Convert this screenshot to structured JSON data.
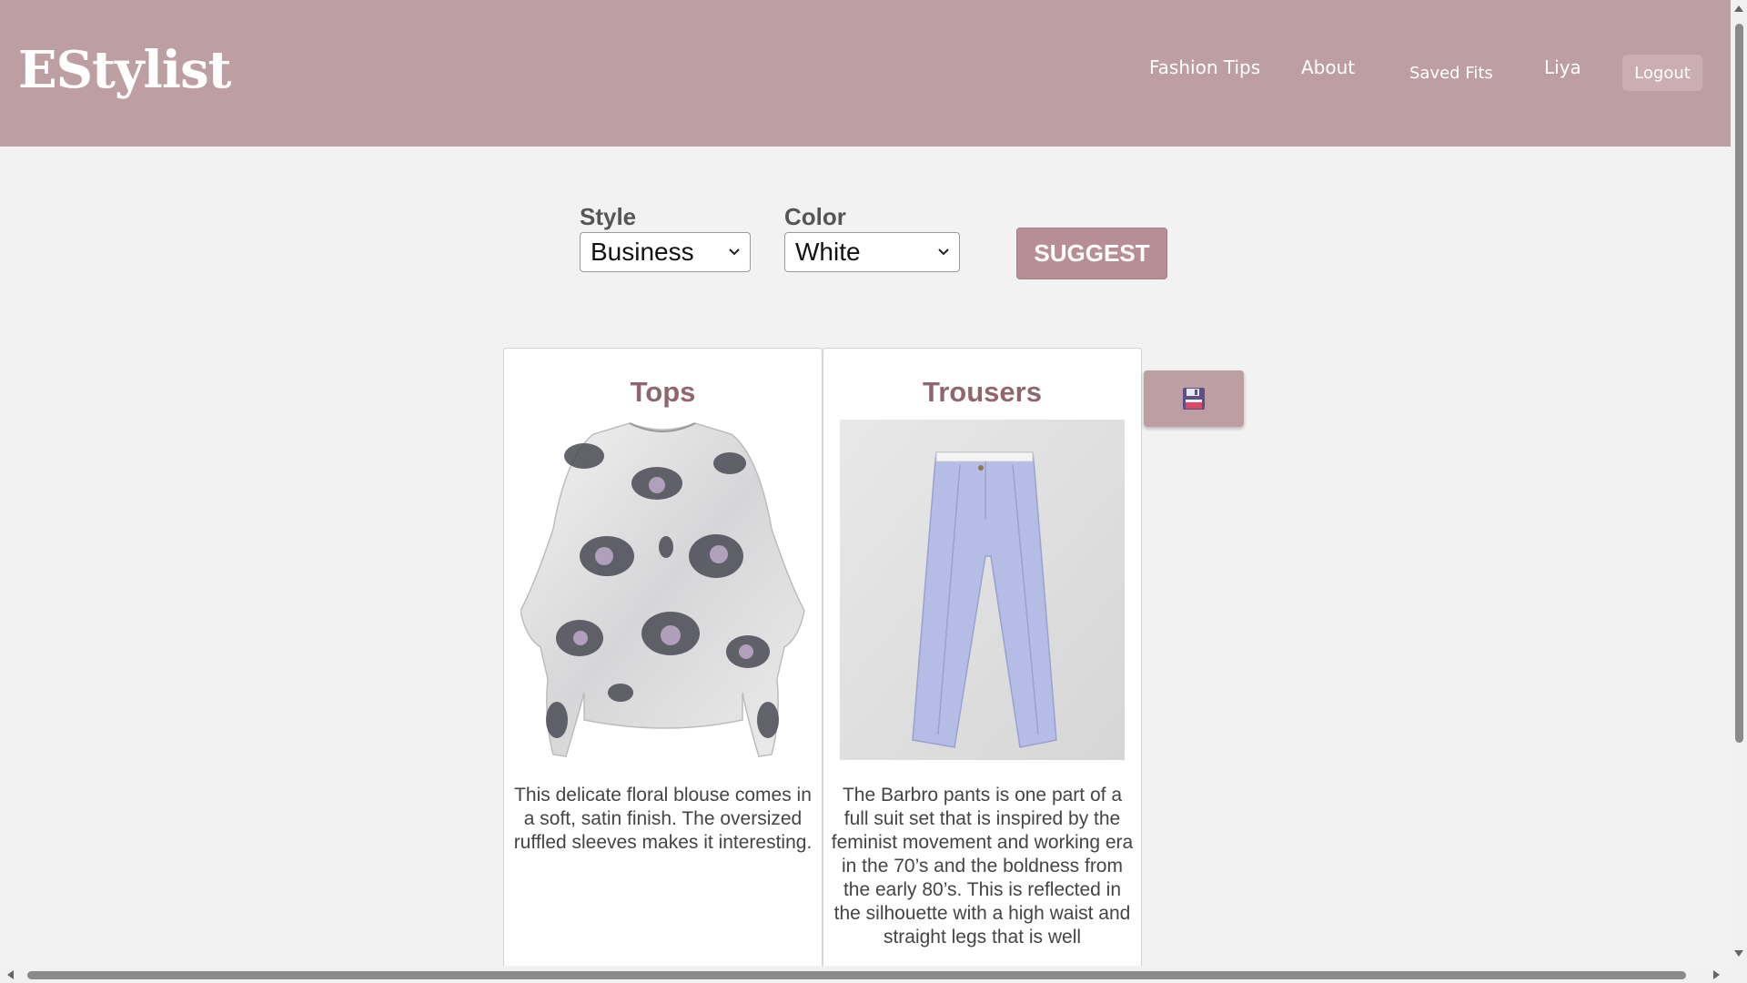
{
  "header": {
    "logo": "EStylist",
    "nav": {
      "fashion_tips": "Fashion Tips",
      "about": "About",
      "saved_fits": "Saved Fits",
      "user": "Liya",
      "logout": "Logout"
    }
  },
  "filters": {
    "style_label": "Style",
    "style_value": "Business",
    "color_label": "Color",
    "color_value": "White",
    "suggest_label": "SUGGEST"
  },
  "cards": [
    {
      "title": "Tops",
      "description": "This delicate floral blouse comes in a soft, satin finish. The oversized ruffled sleeves makes it interesting."
    },
    {
      "title": "Trousers",
      "description": "The Barbro pants is one part of a full suit set that is inspired by the feminist movement and working era in the 70’s and the boldness from the early 80’s. This is reflected in the silhouette with a high waist and straight legs that is well"
    }
  ],
  "save_icon": "floppy-disk-icon",
  "colors": {
    "header_bg": "#bd9ea3",
    "accent": "#b88e96",
    "card_title": "#8f6670",
    "page_bg": "#f3f2f2"
  }
}
